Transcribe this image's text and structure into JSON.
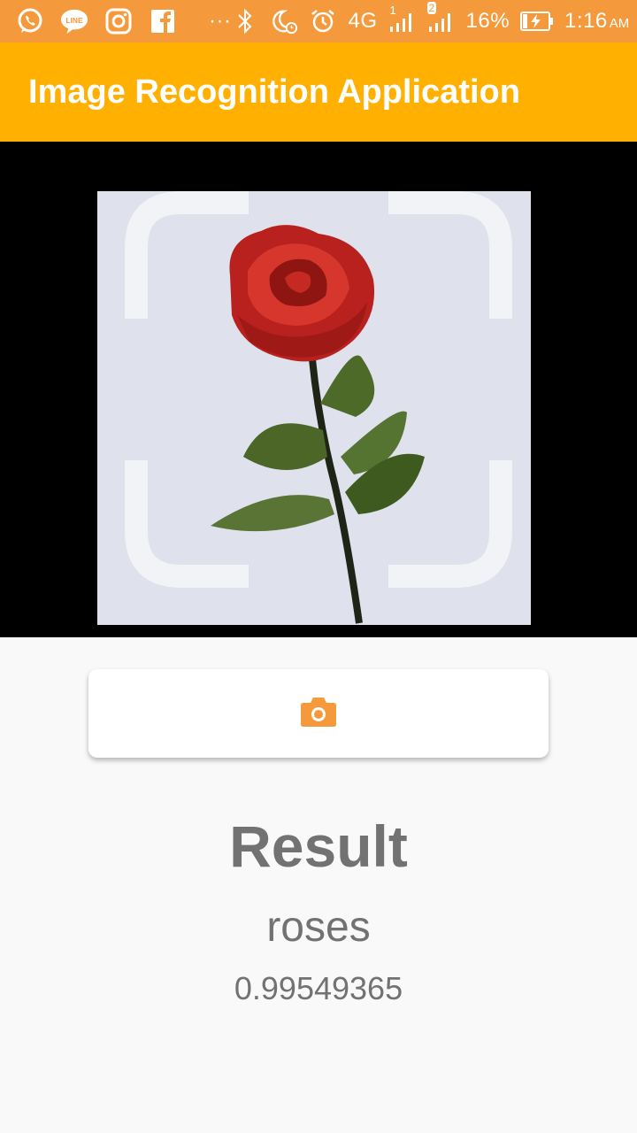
{
  "status_bar": {
    "network": "4G",
    "sim1": "1",
    "sim2": "2",
    "battery": "16%",
    "time": "1:16",
    "ampm": "AM",
    "overflow": "···",
    "icons": [
      "whatsapp-icon",
      "line-icon",
      "instagram-icon",
      "facebook-icon",
      "bluetooth-icon",
      "do-not-disturb-icon",
      "alarm-icon",
      "signal-icon",
      "battery-charging-icon"
    ],
    "line_badge": "LINE"
  },
  "app_bar": {
    "title": "Image Recognition Application"
  },
  "preview": {
    "subject": "red rose photo",
    "frame": "scanner-corners"
  },
  "capture_button": {
    "icon": "camera-icon",
    "accent": "#f49a3c"
  },
  "result": {
    "title": "Result",
    "label": "roses",
    "confidence": "0.99549365"
  },
  "colors": {
    "status_bar": "#f49a3c",
    "app_bar": "#ffb000",
    "text": "#727272",
    "background": "#f9f9f9"
  }
}
